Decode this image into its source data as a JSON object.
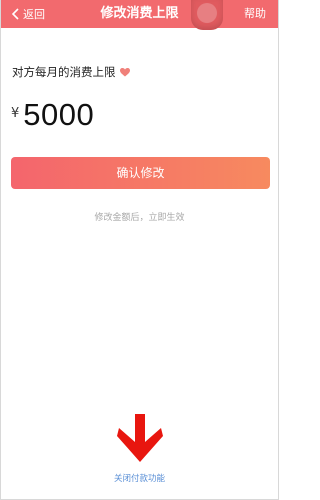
{
  "header": {
    "back_label": "返回",
    "title": "修改消费上限",
    "help_label": "帮助",
    "bg_color": "#f26a6e"
  },
  "main": {
    "limit_label": "对方每月的消费上限",
    "currency_symbol": "¥",
    "amount": "5000",
    "confirm_label": "确认修改",
    "hint": "修改金额后，立即生效",
    "heart_icon": "heart-icon",
    "accent_color": "#f4656d"
  },
  "footer": {
    "close_payment_label": "关闭付款功能",
    "arrow_icon": "down-arrow-icon",
    "arrow_color": "#e8160f"
  }
}
